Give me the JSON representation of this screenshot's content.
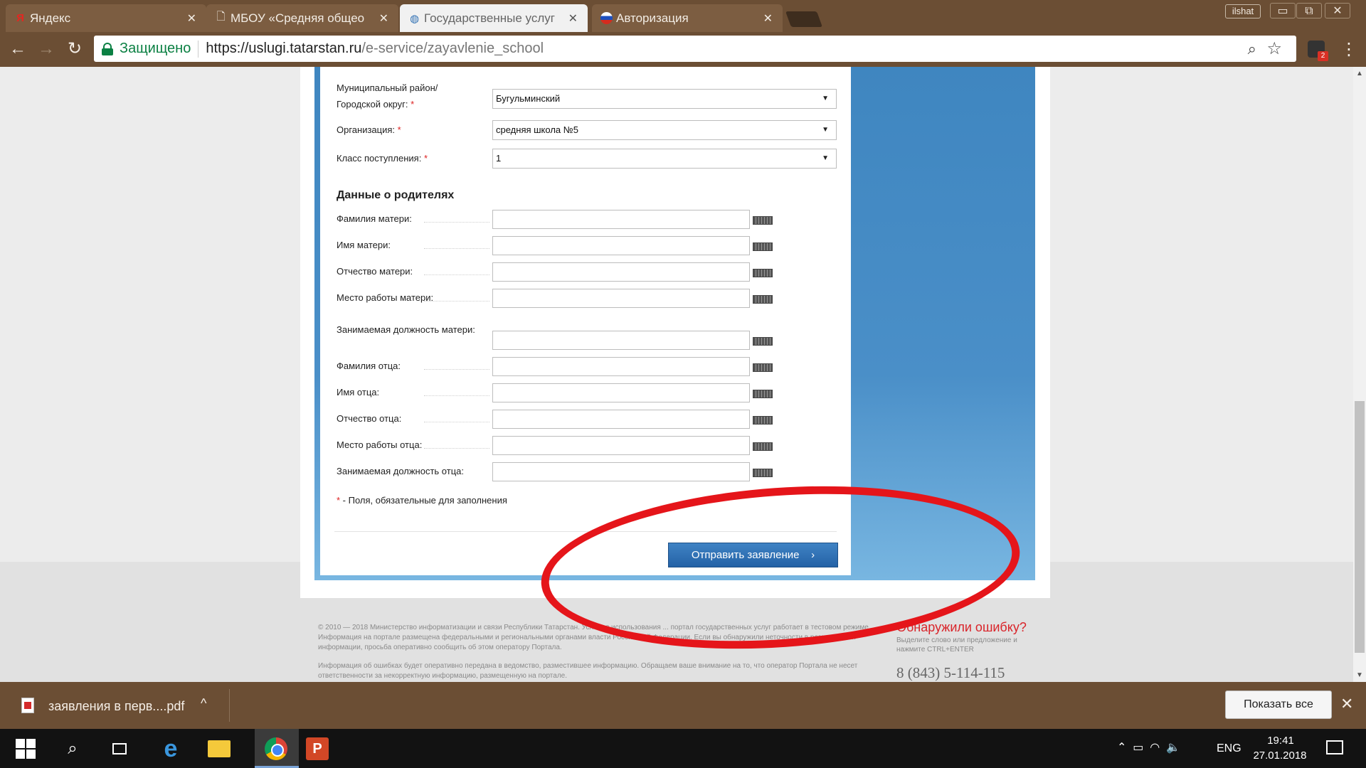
{
  "browser": {
    "tabs": [
      {
        "title": "Яндекс",
        "icon": "yandex-icon"
      },
      {
        "title": "МБОУ «Средняя общео",
        "icon": "page-icon"
      },
      {
        "title": "Государственные услуг",
        "icon": "globe-icon",
        "active": true
      },
      {
        "title": "Авторизация",
        "icon": "russia-flag-icon"
      }
    ],
    "profile": "ilshat",
    "secure_label": "Защищено",
    "url_host": "https://uslugi.tatarstan.ru",
    "url_path": "/e-service/zayavlenie_school",
    "ext_badge": "2"
  },
  "form": {
    "fields_top": [
      {
        "label_line1": "Муниципальный район/",
        "label_line2": "Городской округ:",
        "required": "*",
        "value": "Бугульминский"
      },
      {
        "label": "Организация:",
        "required": "*",
        "value": "средняя школа №5"
      },
      {
        "label": "Класс поступления:",
        "required": "*",
        "value": "1"
      }
    ],
    "parents_heading": "Данные о родителях",
    "parent_fields": [
      "Фамилия матери:",
      "Имя матери:",
      "Отчество матери:",
      "Место работы матери:",
      "Занимаемая должность матери:",
      "Фамилия отца:",
      "Имя отца:",
      "Отчество отца:",
      "Место работы отца:",
      "Занимаемая должность отца:"
    ],
    "required_note_star": "*",
    "required_note": " - Поля, обязательные для заполнения",
    "submit_label": "Отправить заявление",
    "submit_arrow": "›"
  },
  "footer": {
    "text1": "© 2010 — 2018 Министерство информатизации и связи Республики Татарстан. Условия использования ... портал государственных услуг работает в тестовом режиме. Информация на портале размещена федеральными и региональными органами власти Российской Федерации. Если вы обнаружили неточности в размещенной информации, просьба оперативно сообщить об этом оператору Портала.",
    "text2": "Информация об ошибках будет оперативно передана в ведомство, разместившее информацию. Обращаем ваше внимание на то, что оператор Портала не несет ответственности за некорректную информацию, размещенную на портале.",
    "error_title": "Обнаружили ошибку?",
    "error_hint": "Выделите слово или предложение и нажмите CTRL+ENTER",
    "phone": "8 (843) 5-114-115"
  },
  "downloads": {
    "file": "заявления в перв....pdf",
    "show_all": "Показать все"
  },
  "taskbar": {
    "lang": "ENG",
    "time": "19:41",
    "date": "27.01.2018"
  },
  "colors": {
    "annotation": "#e5151a",
    "submit": "#2c6cb0",
    "panel": "#4a8fc8"
  }
}
